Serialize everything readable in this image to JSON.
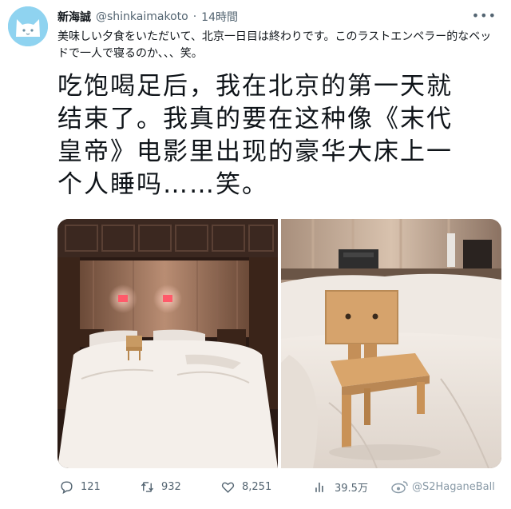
{
  "tweet": {
    "display_name": "新海誠",
    "handle": "@shinkaimakoto",
    "separator": "·",
    "time": "14時間",
    "more_label": "•••",
    "text_jp": "美味しい夕食をいただいて、北京一日目は終わりです。このラストエンペラー的なベッドで一人で寝るのか、、、笑。",
    "text_cn": "吃饱喝足后，我在北京的第一天就结束了。我真的要在这种像《末代皇帝》电影里出现的豪华大床上一个人睡吗……笑。"
  },
  "actions": {
    "replies": "121",
    "retweets": "932",
    "likes": "8,251",
    "views": "39.5万"
  },
  "watermark": "@S2HaganeBall",
  "icons": {
    "avatar": "cat-avatar-icon",
    "reply": "reply-icon",
    "retweet": "retweet-icon",
    "like": "heart-icon",
    "views": "analytics-icon",
    "watermark": "weibo-icon"
  }
}
